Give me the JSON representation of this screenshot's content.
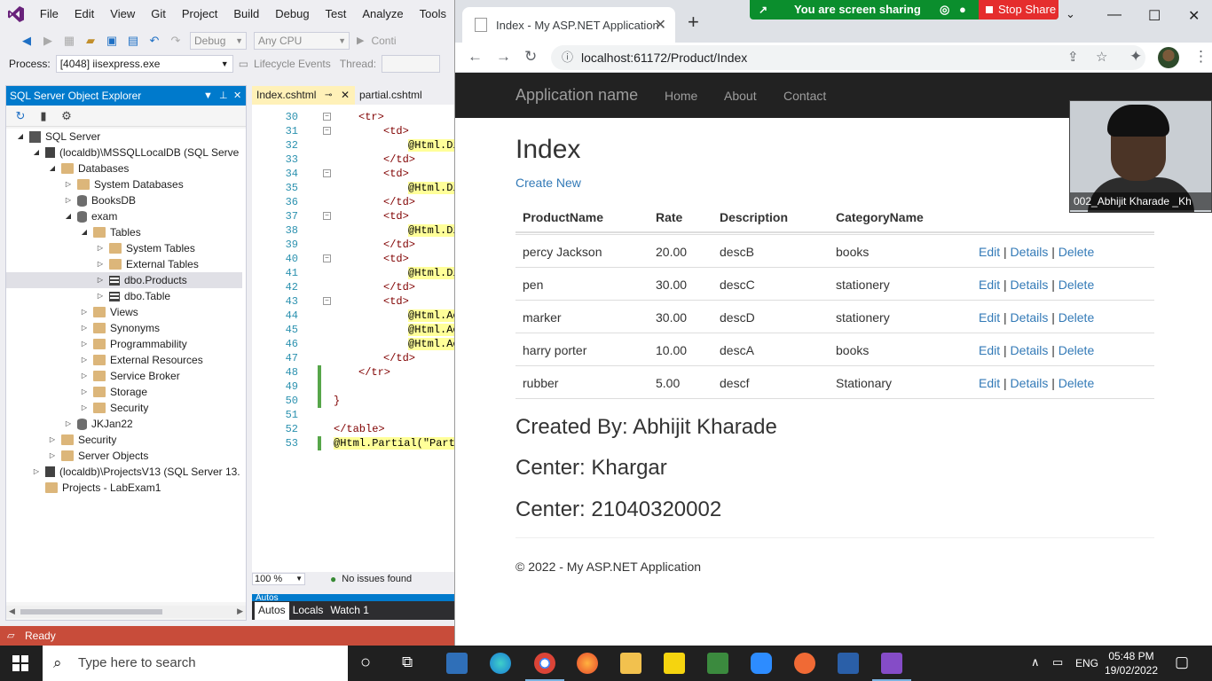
{
  "vs": {
    "menu": [
      "File",
      "Edit",
      "View",
      "Git",
      "Project",
      "Build",
      "Debug",
      "Test",
      "Analyze",
      "Tools"
    ],
    "toolbar": {
      "config": "Debug",
      "platform": "Any CPU",
      "continue": "Conti"
    },
    "process_label": "Process:",
    "process_value": "[4048] iisexpress.exe",
    "lifecycle_label": "Lifecycle Events",
    "thread_label": "Thread:",
    "ssoe": {
      "title": "SQL Server Object Explorer",
      "tree": [
        {
          "label": "SQL Server",
          "depth": 1,
          "arrow": "◢",
          "icon": "root"
        },
        {
          "label": "(localdb)\\MSSQLLocalDB (SQL Serve",
          "depth": 2,
          "arrow": "◢",
          "icon": "server"
        },
        {
          "label": "Databases",
          "depth": 3,
          "arrow": "◢",
          "icon": "folder"
        },
        {
          "label": "System Databases",
          "depth": 4,
          "arrow": "▷",
          "icon": "folder"
        },
        {
          "label": "BooksDB",
          "depth": 4,
          "arrow": "▷",
          "icon": "db"
        },
        {
          "label": "exam",
          "depth": 4,
          "arrow": "◢",
          "icon": "db"
        },
        {
          "label": "Tables",
          "depth": 5,
          "arrow": "◢",
          "icon": "folder"
        },
        {
          "label": "System Tables",
          "depth": 6,
          "arrow": "▷",
          "icon": "folder"
        },
        {
          "label": "External Tables",
          "depth": 6,
          "arrow": "▷",
          "icon": "folder"
        },
        {
          "label": "dbo.Products",
          "depth": 6,
          "arrow": "▷",
          "icon": "table",
          "selected": true
        },
        {
          "label": "dbo.Table",
          "depth": 6,
          "arrow": "▷",
          "icon": "table"
        },
        {
          "label": "Views",
          "depth": 5,
          "arrow": "▷",
          "icon": "folder"
        },
        {
          "label": "Synonyms",
          "depth": 5,
          "arrow": "▷",
          "icon": "folder"
        },
        {
          "label": "Programmability",
          "depth": 5,
          "arrow": "▷",
          "icon": "folder"
        },
        {
          "label": "External Resources",
          "depth": 5,
          "arrow": "▷",
          "icon": "folder"
        },
        {
          "label": "Service Broker",
          "depth": 5,
          "arrow": "▷",
          "icon": "folder"
        },
        {
          "label": "Storage",
          "depth": 5,
          "arrow": "▷",
          "icon": "folder"
        },
        {
          "label": "Security",
          "depth": 5,
          "arrow": "▷",
          "icon": "folder"
        },
        {
          "label": "JKJan22",
          "depth": 4,
          "arrow": "▷",
          "icon": "db"
        },
        {
          "label": "Security",
          "depth": 3,
          "arrow": "▷",
          "icon": "folder"
        },
        {
          "label": "Server Objects",
          "depth": 3,
          "arrow": "▷",
          "icon": "folder"
        },
        {
          "label": "(localdb)\\ProjectsV13 (SQL Server 13.",
          "depth": 2,
          "arrow": "▷",
          "icon": "server"
        },
        {
          "label": "Projects - LabExam1",
          "depth": 2,
          "arrow": "",
          "icon": "folder"
        }
      ]
    },
    "editor": {
      "tabs": [
        "Index.cshtml",
        "partial.cshtml"
      ],
      "lines": [
        {
          "n": "30",
          "indent": 2,
          "text": "<tr>",
          "fold": true
        },
        {
          "n": "31",
          "indent": 4,
          "text": "<td>",
          "fold": true
        },
        {
          "n": "32",
          "indent": 6,
          "text": "@Html.Di",
          "at": true
        },
        {
          "n": "33",
          "indent": 4,
          "text": "</td>"
        },
        {
          "n": "34",
          "indent": 4,
          "text": "<td>",
          "fold": true
        },
        {
          "n": "35",
          "indent": 6,
          "text": "@Html.Di",
          "at": true
        },
        {
          "n": "36",
          "indent": 4,
          "text": "</td>"
        },
        {
          "n": "37",
          "indent": 4,
          "text": "<td>",
          "fold": true
        },
        {
          "n": "38",
          "indent": 6,
          "text": "@Html.Di",
          "at": true
        },
        {
          "n": "39",
          "indent": 4,
          "text": "</td>"
        },
        {
          "n": "40",
          "indent": 4,
          "text": "<td>",
          "fold": true
        },
        {
          "n": "41",
          "indent": 6,
          "text": "@Html.Di",
          "at": true
        },
        {
          "n": "42",
          "indent": 4,
          "text": "</td>"
        },
        {
          "n": "43",
          "indent": 4,
          "text": "<td>",
          "fold": true
        },
        {
          "n": "44",
          "indent": 6,
          "text": "@Html.Ac",
          "at": true
        },
        {
          "n": "45",
          "indent": 6,
          "text": "@Html.Ac",
          "at": true
        },
        {
          "n": "46",
          "indent": 6,
          "text": "@Html.Ac",
          "at": true
        },
        {
          "n": "47",
          "indent": 4,
          "text": "</td>"
        },
        {
          "n": "48",
          "indent": 2,
          "text": "</tr>"
        },
        {
          "n": "49",
          "indent": 0,
          "text": ""
        },
        {
          "n": "50",
          "indent": 0,
          "text": "}"
        },
        {
          "n": "51",
          "indent": 0,
          "text": ""
        },
        {
          "n": "52",
          "indent": 0,
          "text": "</table>"
        },
        {
          "n": "53",
          "indent": 0,
          "text": "@Html.Partial(\"Parti",
          "at": true
        }
      ],
      "zoom": "100 %",
      "issues": "No issues found"
    },
    "autos_head": "Autos",
    "bottom_tabs": [
      "Autos",
      "Locals",
      "Watch 1"
    ],
    "status": "Ready"
  },
  "chrome": {
    "tab_title": "Index - My ASP.NET Application",
    "url": "localhost:61172/Product/Index",
    "sharing_text": "You are screen sharing",
    "stop_share": "Stop Share"
  },
  "site": {
    "brand": "Application name",
    "nav": [
      "Home",
      "About",
      "Contact"
    ],
    "heading": "Index",
    "create_new": "Create New",
    "columns": [
      "ProductName",
      "Rate",
      "Description",
      "CategoryName"
    ],
    "rows": [
      {
        "name": "percy Jackson",
        "rate": "20.00",
        "desc": "descB",
        "cat": "books"
      },
      {
        "name": "pen",
        "rate": "30.00",
        "desc": "descC",
        "cat": "stationery"
      },
      {
        "name": "marker",
        "rate": "30.00",
        "desc": "descD",
        "cat": "stationery"
      },
      {
        "name": "harry porter",
        "rate": "10.00",
        "desc": "descA",
        "cat": "books"
      },
      {
        "name": "rubber",
        "rate": "5.00",
        "desc": "descf",
        "cat": "Stationary"
      }
    ],
    "actions": [
      "Edit",
      "Details",
      "Delete"
    ],
    "created_by": "Created By: Abhijit Kharade",
    "center": "Center: Khargar",
    "center_id": "Center: 21040320002",
    "footer": "© 2022 - My ASP.NET Application"
  },
  "webcam": {
    "name": "002_Abhijit Kharade _Kh"
  },
  "taskbar": {
    "search_placeholder": "Type here to search",
    "language": "ENG",
    "time": "05:48 PM",
    "date": "19/02/2022"
  }
}
